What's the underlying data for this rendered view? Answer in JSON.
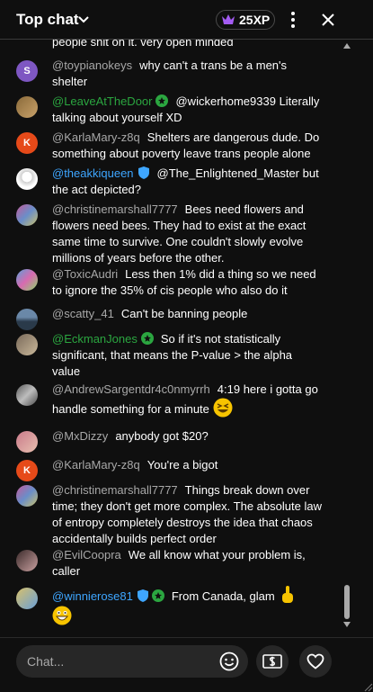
{
  "header": {
    "title": "Top chat",
    "xp": "25XP"
  },
  "cut_text": "people shit on it. very open minded",
  "messages": [
    {
      "author": "@toypianokeys",
      "text": "why can't a trans be a men's shelter",
      "avatar": "S",
      "avatar_color": "#7e57c2"
    },
    {
      "author": "@LeaveAtTheDoor",
      "text": "@wickerhome9339 Literally talking about yourself XD",
      "badge": "member"
    },
    {
      "author": "@KarlaMary-z8q",
      "text": "Shelters are dangerous dude. Do something about poverty leave trans people alone",
      "avatar": "K",
      "avatar_color": "#e64a19"
    },
    {
      "author": "@theakkiqueen",
      "text": "@The_Enlightened_Master but the act depicted?",
      "badge": "verified"
    },
    {
      "author": "@christinemarshall7777",
      "text": "Bees need flowers and flowers need bees. They had to exist at the exact same time to survive. One couldn't slowly evolve millions of years before the other."
    },
    {
      "author": "@ToxicAudri",
      "text": "Less then 1% did a thing so we need to ignore the 35% of cis people who also do it"
    },
    {
      "author": "@scatty_41",
      "text": "Can't be banning people"
    },
    {
      "author": "@EckmanJones",
      "text": "So if it's not statistically significant, that means the P-value > the alpha value",
      "badge": "member"
    },
    {
      "author": "@AndrewSargentdr4c0nmyrrh",
      "text": "4:19 here i gotta go handle something for a minute"
    },
    {
      "author": "@MxDizzy",
      "text": "anybody got $20?"
    },
    {
      "author": "@KarlaMary-z8q",
      "text": "You're a bigot",
      "avatar": "K",
      "avatar_color": "#e64a19"
    },
    {
      "author": "@christinemarshall7777",
      "text": "Things break down over time; they don't get more complex. The absolute law of entropy completely destroys the idea that chaos accidentally builds perfect order"
    },
    {
      "author": "@EvilCoopra",
      "text": "We all know what your problem is, caller"
    },
    {
      "author": "@winnierose81",
      "text": "From Canada, glam",
      "badge": "verified+member"
    }
  ],
  "input": {
    "placeholder": "Chat..."
  },
  "icons": {
    "dropdown": "chevron-down-icon",
    "xp": "crown-icon",
    "menu": "kebab-menu-icon",
    "close": "close-icon",
    "emoji": "smiley-icon",
    "super_chat": "dollar-icon",
    "like": "heart-icon"
  },
  "colors": {
    "member": "#2ba640",
    "verified": "#3ea6ff",
    "author": "#a8a8a8",
    "crown": "#a45cf3"
  }
}
